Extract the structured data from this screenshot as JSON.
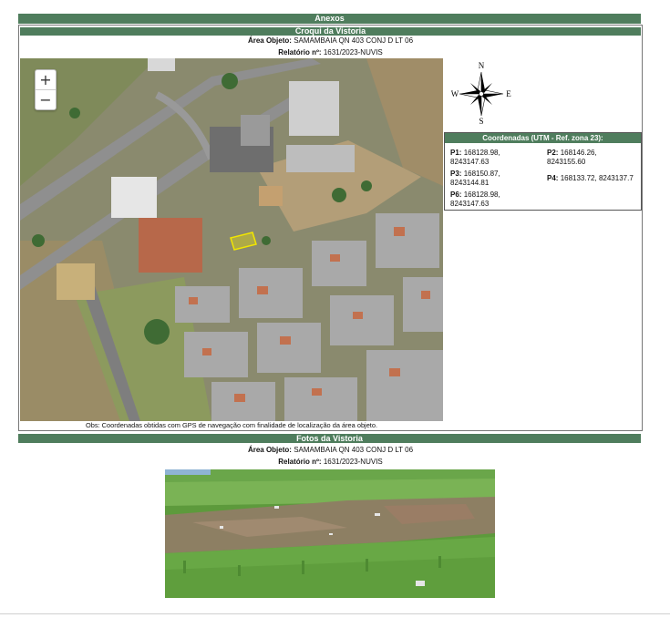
{
  "header": {
    "title": "Anexos"
  },
  "croqui": {
    "title": "Croqui da Vistoria",
    "area_label": "Área Objeto:",
    "area_value": "SAMAMBAIA QN 403 CONJ D LT 06",
    "relatorio_label": "Relatório nº:",
    "relatorio_value": "1631/2023-NUVIS",
    "obs": "Obs: Coordenadas obtidas com GPS de navegação com finalidade de localização da área objeto."
  },
  "map": {
    "zoom_in": "+",
    "zoom_out": "−"
  },
  "compass": {
    "n": "N",
    "s": "S",
    "e": "E",
    "w": "W"
  },
  "coords": {
    "title": "Coordenadas (UTM - Ref. zona 23):",
    "p1_label": "P1:",
    "p1_value": "168128.98,",
    "p1_value2": "8243147.63",
    "p2_label": "P2:",
    "p2_value": "168146.26,",
    "p2_value2": "8243155.60",
    "p3_label": "P3:",
    "p3_value": "168150.87,",
    "p3_value2": "8243144.81",
    "p4_label": "P4:",
    "p4_value": "168133.72, 8243137.7",
    "p5_label": "P6:",
    "p5_value": "168128.98,",
    "p5_value2": "8243147.63"
  },
  "fotos": {
    "title": "Fotos da Vistoria",
    "area_label": "Área Objeto:",
    "area_value": "SAMAMBAIA QN 403 CONJ D LT 06",
    "relatorio_label": "Relatório nº:",
    "relatorio_value": "1631/2023-NUVIS"
  },
  "colors": {
    "accent": "#4f7d5d",
    "parcel": "#f2e600"
  }
}
